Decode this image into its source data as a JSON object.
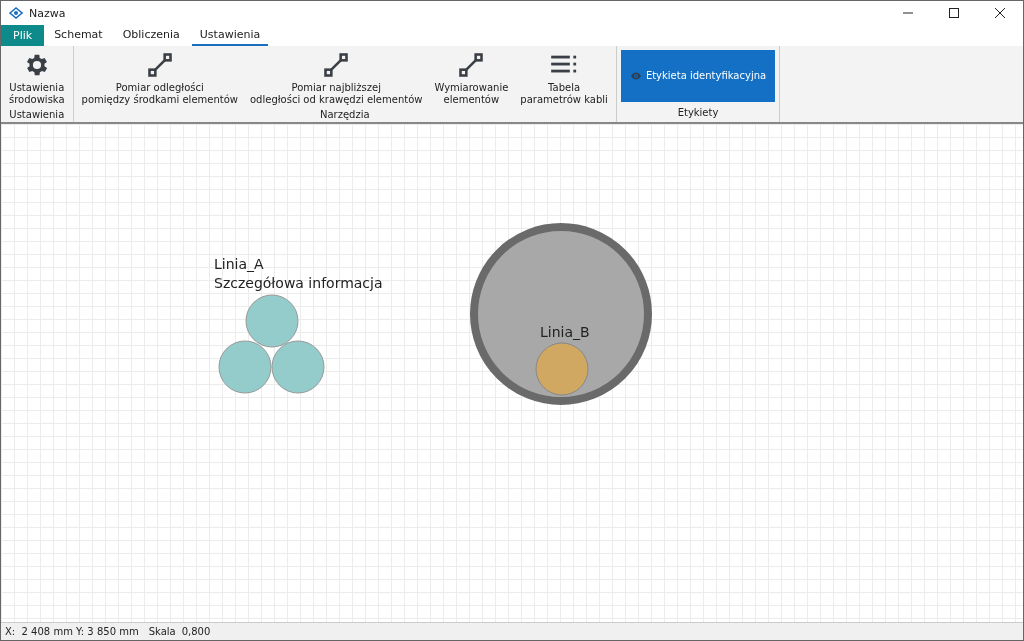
{
  "window": {
    "title": "Nazwa"
  },
  "file_tab": {
    "label": "Plik"
  },
  "tabs": [
    {
      "label": "Schemat",
      "selected": false
    },
    {
      "label": "Obliczenia",
      "selected": false
    },
    {
      "label": "Ustawienia",
      "selected": true
    }
  ],
  "ribbon": {
    "groups": [
      {
        "label": "Ustawienia",
        "buttons": [
          {
            "kind": "gear",
            "lines": [
              "Ustawienia",
              "środowiska"
            ]
          }
        ]
      },
      {
        "label": "Narzędzia",
        "buttons": [
          {
            "kind": "measure",
            "lines": [
              "Pomiar odległości",
              "pomiędzy środkami elementów"
            ]
          },
          {
            "kind": "measure",
            "lines": [
              "Pomiar najbliższej",
              "odległości od krawędzi elementów"
            ]
          },
          {
            "kind": "measure",
            "lines": [
              "Wymiarowanie",
              "elementów"
            ]
          },
          {
            "kind": "table",
            "lines": [
              "Tabela",
              "parametrów kabli"
            ]
          }
        ]
      },
      {
        "label": "Etykiety",
        "buttons": [
          {
            "kind": "toggle",
            "on": true,
            "lines": [
              "Etykieta identyfikacyjna"
            ]
          }
        ]
      }
    ]
  },
  "canvas": {
    "cables": [
      {
        "kind": "bundle",
        "label": "Linia_A",
        "detail": "Szczegółowa informacja",
        "color": "#93cccb"
      },
      {
        "kind": "conduit",
        "label": "Linia_B",
        "color": "#d1a862"
      }
    ]
  },
  "status_bar": {
    "position": "X:  2 408 mm Y: 3 850 mm",
    "scale_label": "Skala",
    "scale": "0,800"
  }
}
